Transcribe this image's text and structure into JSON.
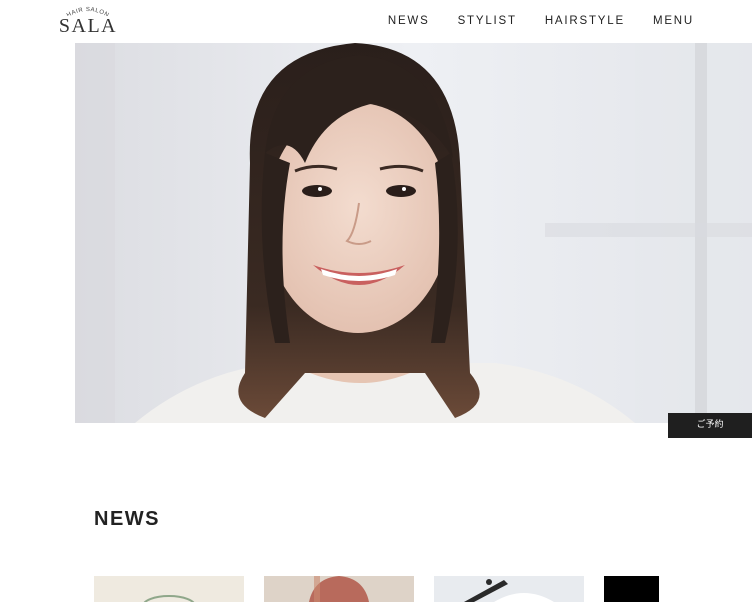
{
  "header": {
    "logo_small": "HAIR SALON",
    "logo_main": "SALA",
    "nav": [
      {
        "label": "NEWS"
      },
      {
        "label": "STYLIST"
      },
      {
        "label": "HAIRSTYLE"
      },
      {
        "label": "MENU"
      }
    ]
  },
  "hero": {
    "image": "smiling-woman-portrait"
  },
  "reserve_button": {
    "label": "ご予約"
  },
  "news": {
    "heading": "NEWS",
    "cards": [
      {
        "image": "green-glass-thumbnail"
      },
      {
        "image": "pink-hair-thumbnail"
      },
      {
        "image": "hair-tools-thumbnail"
      },
      {
        "image": "dark-thumbnail"
      }
    ]
  },
  "colors": {
    "text": "#222222",
    "button_bg": "#1f1f1f",
    "hero_bg": "#e9eaee"
  }
}
